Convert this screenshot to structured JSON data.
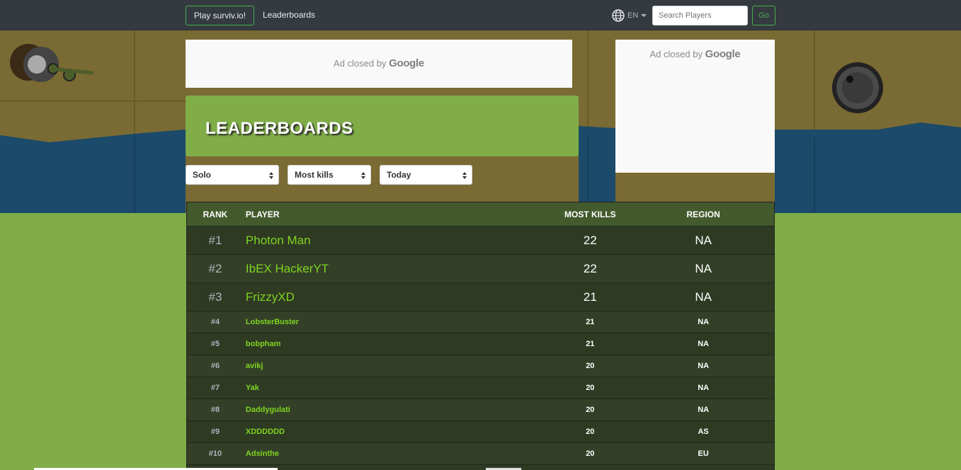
{
  "navbar": {
    "play_label": "Play surviv.io!",
    "leaderboards_label": "Leaderboards",
    "language": "EN",
    "search_placeholder": "Search Players",
    "go_label": "Go"
  },
  "ads": {
    "top_text": "Ad closed by",
    "top_brand": "Google",
    "side_text": "Ad closed by",
    "side_brand": "Google"
  },
  "banner": {
    "title": "LEADERBOARDS"
  },
  "filters": {
    "mode": "Solo",
    "stat": "Most kills",
    "time": "Today"
  },
  "table": {
    "headers": {
      "rank": "RANK",
      "player": "PLAYER",
      "kills": "MOST KILLS",
      "region": "REGION"
    },
    "rows": [
      {
        "rank": "#1",
        "player": "Photon Man",
        "kills": "22",
        "region": "NA"
      },
      {
        "rank": "#2",
        "player": "IbEX HackerYT",
        "kills": "22",
        "region": "NA"
      },
      {
        "rank": "#3",
        "player": "FrizzyXD",
        "kills": "21",
        "region": "NA"
      },
      {
        "rank": "#4",
        "player": "LobsterBuster",
        "kills": "21",
        "region": "NA"
      },
      {
        "rank": "#5",
        "player": "bobpham",
        "kills": "21",
        "region": "NA"
      },
      {
        "rank": "#6",
        "player": "avikj",
        "kills": "20",
        "region": "NA"
      },
      {
        "rank": "#7",
        "player": "Yak",
        "kills": "20",
        "region": "NA"
      },
      {
        "rank": "#8",
        "player": "Daddygulati",
        "kills": "20",
        "region": "NA"
      },
      {
        "rank": "#9",
        "player": "XDDDDDD",
        "kills": "20",
        "region": "AS"
      },
      {
        "rank": "#10",
        "player": "Adsinthe",
        "kills": "20",
        "region": "EU"
      }
    ]
  },
  "colors": {
    "navbar": "#343a40",
    "accent_green": "#46b04c",
    "banner": "#80ad48",
    "player_name": "#7ed321",
    "water": "#1c4a6a",
    "sand": "#7a6a33"
  },
  "icons": {
    "globe": "globe-icon",
    "caret": "caret-down-icon"
  }
}
